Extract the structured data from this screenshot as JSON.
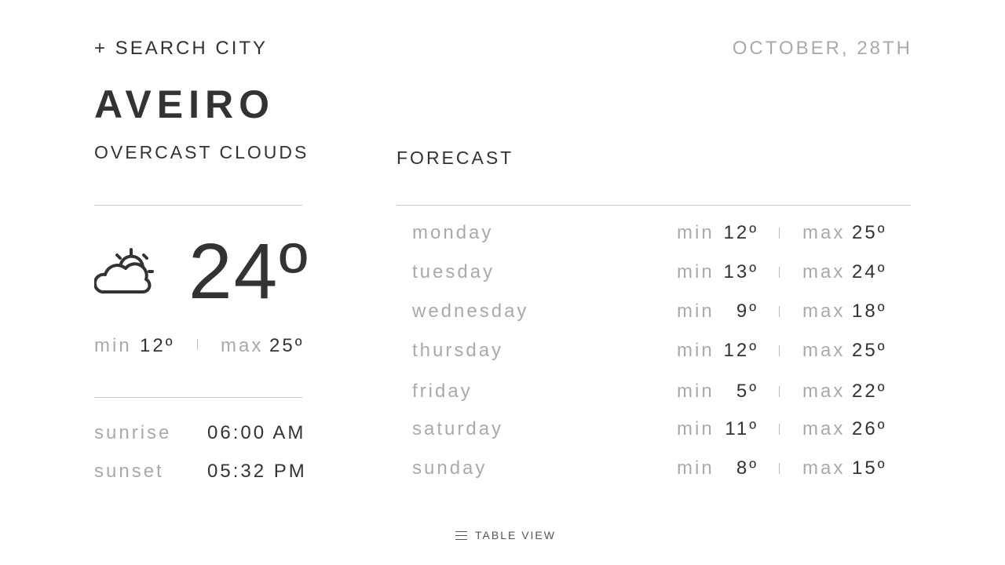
{
  "header": {
    "search_label": "+ SEARCH CITY",
    "date": "OCTOBER, 28TH"
  },
  "current": {
    "city": "AVEIRO",
    "condition": "OVERCAST CLOUDS",
    "icon": "partly-cloudy-sun-icon",
    "temperature": "24º",
    "min_label": "min",
    "min_value": "12º",
    "max_label": "max",
    "max_value": "25º",
    "sunrise_label": "sunrise",
    "sunrise_value": "06:00 AM",
    "sunset_label": "sunset",
    "sunset_value": "05:32 PM"
  },
  "forecast": {
    "title": "FORECAST",
    "min_label": "min",
    "max_label": "max",
    "days": [
      {
        "day": "monday",
        "min": "12º",
        "max": "25º"
      },
      {
        "day": "tuesday",
        "min": "13º",
        "max": "24º"
      },
      {
        "day": "wednesday",
        "min": "9º",
        "max": "18º"
      },
      {
        "day": "thursday",
        "min": "12º",
        "max": "25º"
      },
      {
        "day": "friday",
        "min": "5º",
        "max": "22º"
      },
      {
        "day": "saturday",
        "min": "11º",
        "max": "26º"
      },
      {
        "day": "sunday",
        "min": "8º",
        "max": "15º"
      }
    ]
  },
  "footer": {
    "icon": "menu-icon",
    "table_view_label": "TABLE VIEW"
  },
  "colors": {
    "text_dark": "#333333",
    "text_muted": "#aaaaaa",
    "rule": "#c8c8c8",
    "background": "#ffffff"
  }
}
